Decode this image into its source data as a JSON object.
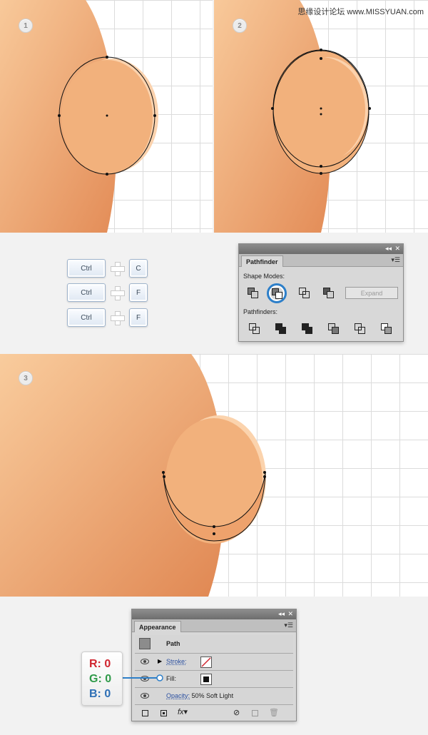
{
  "watermark": "思缘设计论坛 www.MISSYUAN.com",
  "steps": [
    "1",
    "2",
    "3"
  ],
  "shortcuts": [
    {
      "mod": "Ctrl",
      "key": "C"
    },
    {
      "mod": "Ctrl",
      "key": "F"
    },
    {
      "mod": "Ctrl",
      "key": "F"
    }
  ],
  "pathfinder": {
    "title": "Pathfinder",
    "collapse": "◂◂",
    "close": "✕",
    "menu": "▾☰",
    "shape_modes_label": "Shape Modes:",
    "pathfinders_label": "Pathfinders:",
    "expand_label": "Expand"
  },
  "appearance": {
    "title": "Appearance",
    "collapse": "◂◂",
    "close": "✕",
    "menu": "▾☰",
    "path_label": "Path",
    "stroke_label": "Stroke:",
    "fill_label": "Fill:",
    "opacity_label": "Opacity:",
    "opacity_value": "50% Soft Light"
  },
  "rgb": {
    "r": "R: 0",
    "g": "G: 0",
    "b": "B: 0"
  },
  "colors": {
    "skin_light": "#fad3a6",
    "skin_dark": "#e28a55",
    "ear_fill": "#f2b17c",
    "highlight_blue": "#2d7fc9",
    "r_color": "#d0252f",
    "g_color": "#2f9a49",
    "b_color": "#2e6fb5"
  }
}
